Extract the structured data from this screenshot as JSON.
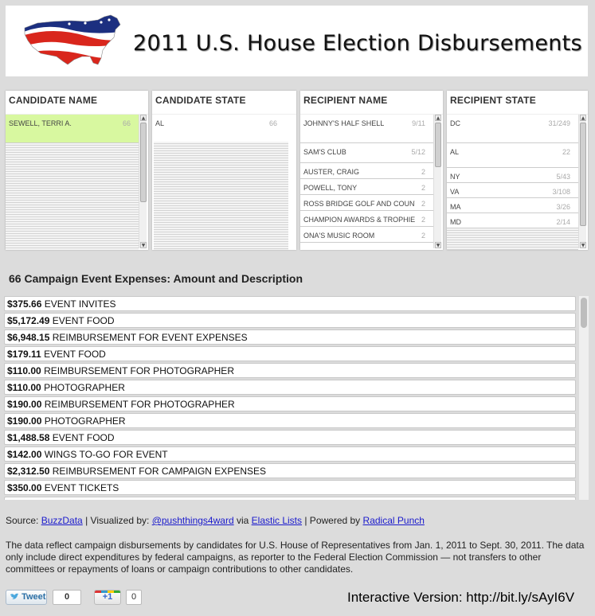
{
  "header": {
    "title": "2011 U.S. House Election Disbursements"
  },
  "facets": [
    {
      "header": "CANDIDATE NAME",
      "items": [
        {
          "label": "SEWELL, TERRI A.",
          "count": "66",
          "selected": true
        }
      ]
    },
    {
      "header": "CANDIDATE STATE",
      "items": [
        {
          "label": "AL",
          "count": "66",
          "selected": false
        }
      ]
    },
    {
      "header": "RECIPIENT NAME",
      "items": [
        {
          "label": "JOHNNY'S HALF SHELL",
          "count": "9/11"
        },
        {
          "label": "SAM'S CLUB",
          "count": "5/12"
        },
        {
          "label": "AUSTER, CRAIG",
          "count": "2"
        },
        {
          "label": "POWELL, TONY",
          "count": "2"
        },
        {
          "label": "ROSS BRIDGE GOLF AND COUNTRY",
          "count": "2"
        },
        {
          "label": "CHAMPION AWARDS & TROPHIES",
          "count": "2"
        },
        {
          "label": "ONA'S MUSIC ROOM",
          "count": "2"
        }
      ]
    },
    {
      "header": "RECIPIENT STATE",
      "items": [
        {
          "label": "DC",
          "count": "31/249"
        },
        {
          "label": "AL",
          "count": "22"
        },
        {
          "label": "NY",
          "count": "5/43"
        },
        {
          "label": "VA",
          "count": "3/108"
        },
        {
          "label": "MA",
          "count": "3/26"
        },
        {
          "label": "MD",
          "count": "2/14"
        }
      ]
    }
  ],
  "section_title": "66 Campaign Event Expenses: Amount and Description",
  "expenses": [
    {
      "amount": "$375.66",
      "description": "EVENT INVITES"
    },
    {
      "amount": "$5,172.49",
      "description": "EVENT FOOD"
    },
    {
      "amount": "$6,948.15",
      "description": "REIMBURSEMENT FOR EVENT EXPENSES"
    },
    {
      "amount": "$179.11",
      "description": "EVENT FOOD"
    },
    {
      "amount": "$110.00",
      "description": "REIMBURSEMENT FOR PHOTOGRAPHER"
    },
    {
      "amount": "$110.00",
      "description": "PHOTOGRAPHER"
    },
    {
      "amount": "$190.00",
      "description": "REIMBURSEMENT FOR PHOTOGRAPHER"
    },
    {
      "amount": "$190.00",
      "description": "PHOTOGRAPHER"
    },
    {
      "amount": "$1,488.58",
      "description": "EVENT FOOD"
    },
    {
      "amount": "$142.00",
      "description": "WINGS TO-GO FOR EVENT"
    },
    {
      "amount": "$2,312.50",
      "description": "REIMBURSEMENT FOR CAMPAIGN EXPENSES"
    },
    {
      "amount": "$350.00",
      "description": "EVENT TICKETS"
    }
  ],
  "source": {
    "source_label": "Source:",
    "source_link": "BuzzData",
    "sep1": "| Visualized by:",
    "visualized_link": "@pushthings4ward",
    "via": "via",
    "elastic_link": "Elastic Lists",
    "sep2": "| Powered by",
    "powered_link": "Radical Punch"
  },
  "description": "The data reflect campaign disbursements by candidates for U.S. House of Representatives from Jan. 1, 2011 to Sept. 30, 2011. The data only include direct expenditures by federal campaigns, as reporter to the Federal Election Commission — not transfers to other committees or repayments of loans or campaign contributions to other candidates.",
  "social": {
    "tweet_label": "Tweet",
    "tweet_count": "0",
    "plus_label": "+1",
    "plus_count": "0"
  },
  "interactive_version": "Interactive Version: http://bit.ly/sAyI6V",
  "colors": {
    "selected_row": "#d8f8a0",
    "link": "#1a1acc",
    "background": "#dcdcdc"
  },
  "icons": [
    "us-flag-map-icon",
    "twitter-bird-icon",
    "google-plus-icon",
    "scroll-up-arrow-icon",
    "scroll-down-arrow-icon"
  ]
}
